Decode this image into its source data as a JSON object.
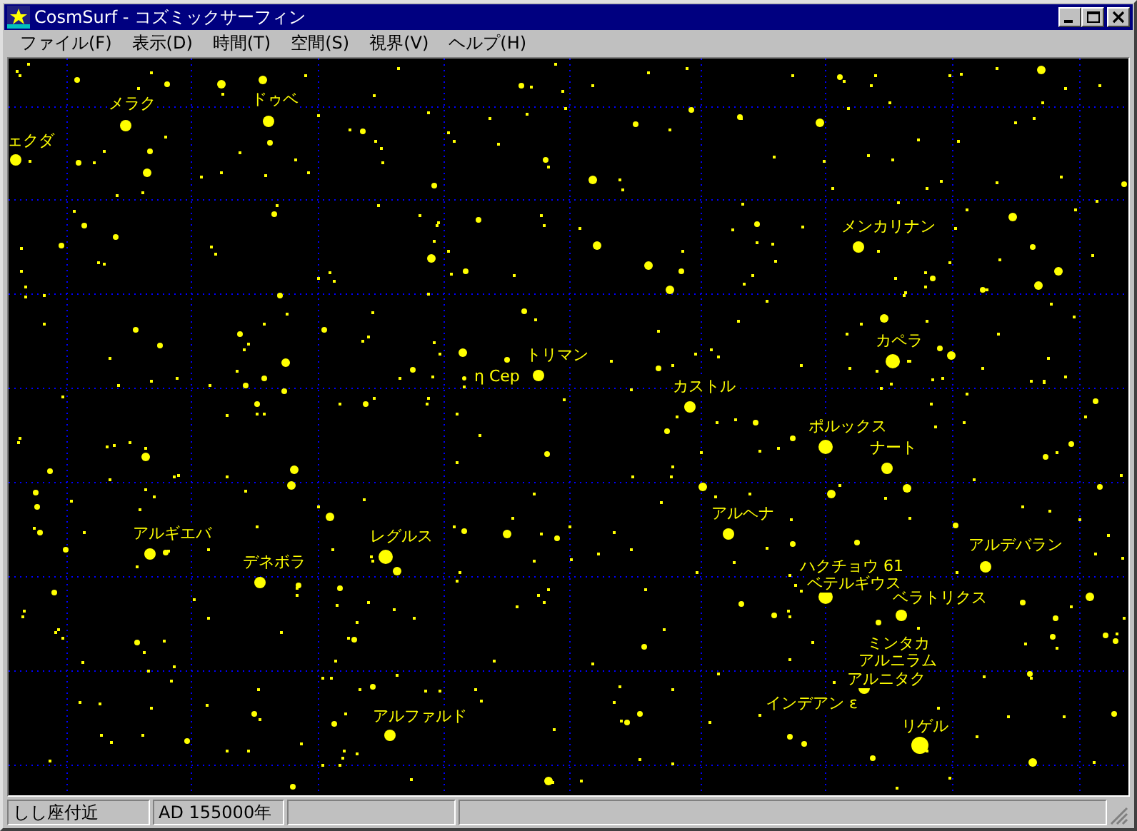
{
  "window": {
    "title": "CosmSurf - コズミックサーフィン"
  },
  "menu": [
    "ファイル(F)",
    "表示(D)",
    "時間(T)",
    "空間(S)",
    "視界(V)",
    "ヘルプ(H)"
  ],
  "sky_map": {
    "star_labels": [
      "メラク",
      "ドゥベ",
      "ェクダ",
      "η Cep",
      "トリマン",
      "カストル",
      "メンカリナン",
      "カペラ",
      "ポルックス",
      "ナート",
      "アルヘナ",
      "アルデバラン",
      "ハクチョウ 61",
      "ベテルギウス",
      "ベラトリクス",
      "ミンタカ",
      "アルニラム",
      "アルニタク",
      "インデアン ε",
      "リゲル",
      "アルギエバ",
      "デネボラ",
      "レグルス",
      "アルファルド"
    ]
  },
  "status_bar": [
    "しし座付近",
    "AD 155000年"
  ]
}
